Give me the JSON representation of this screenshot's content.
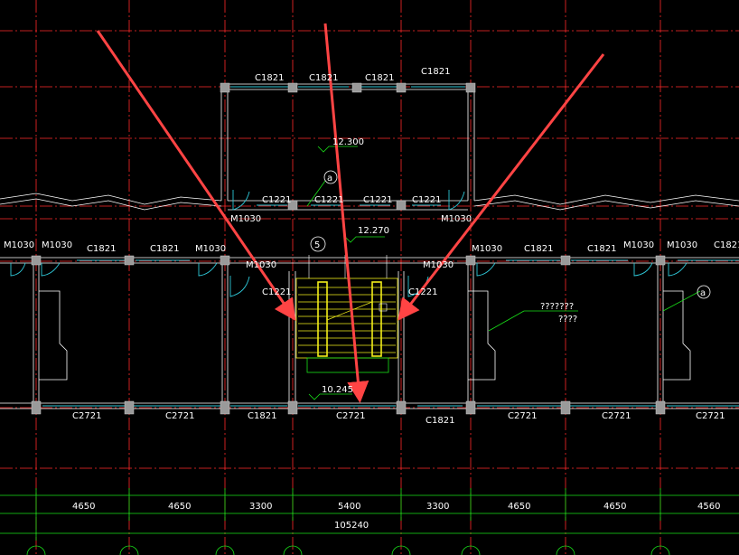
{
  "colors": {
    "background": "#000000",
    "grid": "#ff2a2a",
    "wall": "#ffffff",
    "column": "#9a9a9a",
    "window": "#2ec6d6",
    "door": "#2ec6d6",
    "stair": "#f2ee1a",
    "dimension": "#18e018",
    "arrow": "#ff4444",
    "text": "#ffffff"
  },
  "window_labels": {
    "top_row": [
      "C1821",
      "C1821",
      "C1821",
      "C1821"
    ],
    "corridor_upper": [
      "C1221",
      "C1221",
      "C1221",
      "C1221"
    ],
    "outer_top": [
      "C1821",
      "C1821",
      "C1821"
    ],
    "inner": [
      "C1221",
      "C1221"
    ],
    "bottom": [
      "C2721",
      "C2721",
      "C1821",
      "C2721",
      "C1821",
      "C2721",
      "C2721",
      "C2721"
    ]
  },
  "door_labels": {
    "left_group": [
      "M1030",
      "M1030",
      "M1030"
    ],
    "mid": [
      "M1030",
      "M1030",
      "M1030",
      "M1030"
    ],
    "right_group": [
      "M1030",
      "M1030",
      "M1030"
    ]
  },
  "elevations": [
    "12.300",
    "12.270",
    "10.245"
  ],
  "axis_bubbles": [
    "a",
    "5",
    "a"
  ],
  "annotation": {
    "line1": "???????",
    "line2": "????"
  },
  "dimensions": {
    "segments": [
      "4650",
      "4650",
      "3300",
      "5400",
      "3300",
      "4650",
      "4650",
      "4560"
    ],
    "total": "105240"
  }
}
